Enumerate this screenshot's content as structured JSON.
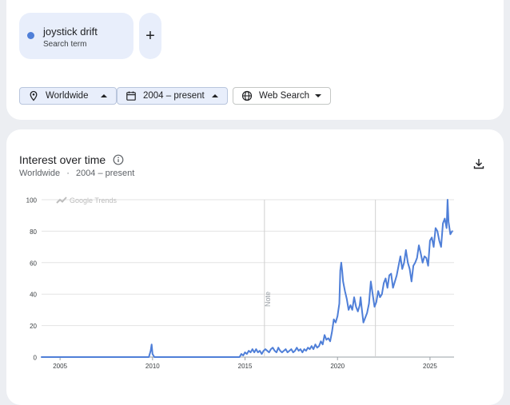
{
  "search_term": {
    "name": "joystick drift",
    "subtitle": "Search term",
    "color": "#4f7fd8"
  },
  "add_button": {
    "label": "+"
  },
  "filters": [
    {
      "label": "Worldwide",
      "icon": "location-pin-icon"
    },
    {
      "label": "2004 – present",
      "icon": "calendar-icon"
    },
    {
      "label": "Web Search",
      "icon": "globe-icon"
    }
  ],
  "chart": {
    "title": "Interest over time",
    "subtitle_region": "Worldwide",
    "subtitle_sep": "·",
    "subtitle_range": "2004 – present",
    "watermark": "Google Trends",
    "note_label": "Note"
  },
  "chart_data": {
    "type": "line",
    "series": [
      {
        "name": "joystick drift",
        "color": "#4f7fd8",
        "points": [
          [
            2004.0,
            0
          ],
          [
            2009.8,
            0
          ],
          [
            2009.9,
            4
          ],
          [
            2009.95,
            8
          ],
          [
            2010.0,
            2
          ],
          [
            2010.1,
            0
          ],
          [
            2014.7,
            0
          ],
          [
            2014.8,
            2
          ],
          [
            2014.9,
            1
          ],
          [
            2015.0,
            3
          ],
          [
            2015.1,
            2
          ],
          [
            2015.2,
            4
          ],
          [
            2015.3,
            3
          ],
          [
            2015.4,
            5
          ],
          [
            2015.5,
            3
          ],
          [
            2015.6,
            5
          ],
          [
            2015.7,
            3
          ],
          [
            2015.8,
            4
          ],
          [
            2015.9,
            2
          ],
          [
            2016.0,
            4
          ],
          [
            2016.1,
            5
          ],
          [
            2016.2,
            4
          ],
          [
            2016.3,
            3
          ],
          [
            2016.4,
            5
          ],
          [
            2016.5,
            6
          ],
          [
            2016.6,
            4
          ],
          [
            2016.7,
            3
          ],
          [
            2016.8,
            6
          ],
          [
            2016.9,
            4
          ],
          [
            2017.0,
            3
          ],
          [
            2017.1,
            4
          ],
          [
            2017.2,
            5
          ],
          [
            2017.3,
            3
          ],
          [
            2017.4,
            4
          ],
          [
            2017.5,
            5
          ],
          [
            2017.6,
            3
          ],
          [
            2017.7,
            4
          ],
          [
            2017.8,
            6
          ],
          [
            2017.9,
            4
          ],
          [
            2018.0,
            5
          ],
          [
            2018.1,
            3
          ],
          [
            2018.2,
            5
          ],
          [
            2018.3,
            4
          ],
          [
            2018.4,
            6
          ],
          [
            2018.5,
            5
          ],
          [
            2018.6,
            7
          ],
          [
            2018.7,
            5
          ],
          [
            2018.8,
            8
          ],
          [
            2018.9,
            6
          ],
          [
            2019.0,
            7
          ],
          [
            2019.1,
            10
          ],
          [
            2019.2,
            8
          ],
          [
            2019.3,
            14
          ],
          [
            2019.4,
            11
          ],
          [
            2019.5,
            12
          ],
          [
            2019.6,
            10
          ],
          [
            2019.7,
            16
          ],
          [
            2019.8,
            24
          ],
          [
            2019.9,
            22
          ],
          [
            2020.0,
            26
          ],
          [
            2020.1,
            34
          ],
          [
            2020.15,
            55
          ],
          [
            2020.2,
            60
          ],
          [
            2020.25,
            55
          ],
          [
            2020.3,
            48
          ],
          [
            2020.4,
            42
          ],
          [
            2020.5,
            37
          ],
          [
            2020.6,
            30
          ],
          [
            2020.7,
            33
          ],
          [
            2020.8,
            30
          ],
          [
            2020.9,
            38
          ],
          [
            2021.0,
            32
          ],
          [
            2021.1,
            29
          ],
          [
            2021.2,
            33
          ],
          [
            2021.25,
            38
          ],
          [
            2021.3,
            32
          ],
          [
            2021.4,
            22
          ],
          [
            2021.5,
            25
          ],
          [
            2021.6,
            28
          ],
          [
            2021.7,
            34
          ],
          [
            2021.8,
            48
          ],
          [
            2021.9,
            40
          ],
          [
            2022.0,
            32
          ],
          [
            2022.1,
            35
          ],
          [
            2022.2,
            42
          ],
          [
            2022.3,
            38
          ],
          [
            2022.4,
            40
          ],
          [
            2022.5,
            47
          ],
          [
            2022.6,
            50
          ],
          [
            2022.7,
            44
          ],
          [
            2022.8,
            52
          ],
          [
            2022.9,
            53
          ],
          [
            2023.0,
            44
          ],
          [
            2023.1,
            48
          ],
          [
            2023.2,
            52
          ],
          [
            2023.3,
            58
          ],
          [
            2023.4,
            64
          ],
          [
            2023.5,
            56
          ],
          [
            2023.6,
            60
          ],
          [
            2023.7,
            68
          ],
          [
            2023.8,
            60
          ],
          [
            2023.9,
            56
          ],
          [
            2024.0,
            48
          ],
          [
            2024.1,
            58
          ],
          [
            2024.2,
            60
          ],
          [
            2024.3,
            63
          ],
          [
            2024.4,
            71
          ],
          [
            2024.5,
            66
          ],
          [
            2024.6,
            60
          ],
          [
            2024.7,
            64
          ],
          [
            2024.8,
            63
          ],
          [
            2024.9,
            58
          ],
          [
            2025.0,
            74
          ],
          [
            2025.1,
            76
          ],
          [
            2025.2,
            70
          ],
          [
            2025.3,
            82
          ],
          [
            2025.4,
            80
          ],
          [
            2025.5,
            74
          ],
          [
            2025.6,
            70
          ],
          [
            2025.7,
            85
          ],
          [
            2025.8,
            88
          ],
          [
            2025.9,
            82
          ],
          [
            2025.95,
            100
          ],
          [
            2026.0,
            86
          ],
          [
            2026.1,
            78
          ],
          [
            2026.2,
            80
          ]
        ]
      }
    ],
    "x_ticks": [
      2005,
      2010,
      2015,
      2020,
      2025
    ],
    "y_ticks": [
      0,
      20,
      40,
      60,
      80,
      100
    ],
    "xlim": [
      2004.0,
      2026.3
    ],
    "ylim": [
      0,
      100
    ],
    "note_markers": [
      2016.05,
      2022.05
    ],
    "grid": true,
    "legend": "none"
  }
}
